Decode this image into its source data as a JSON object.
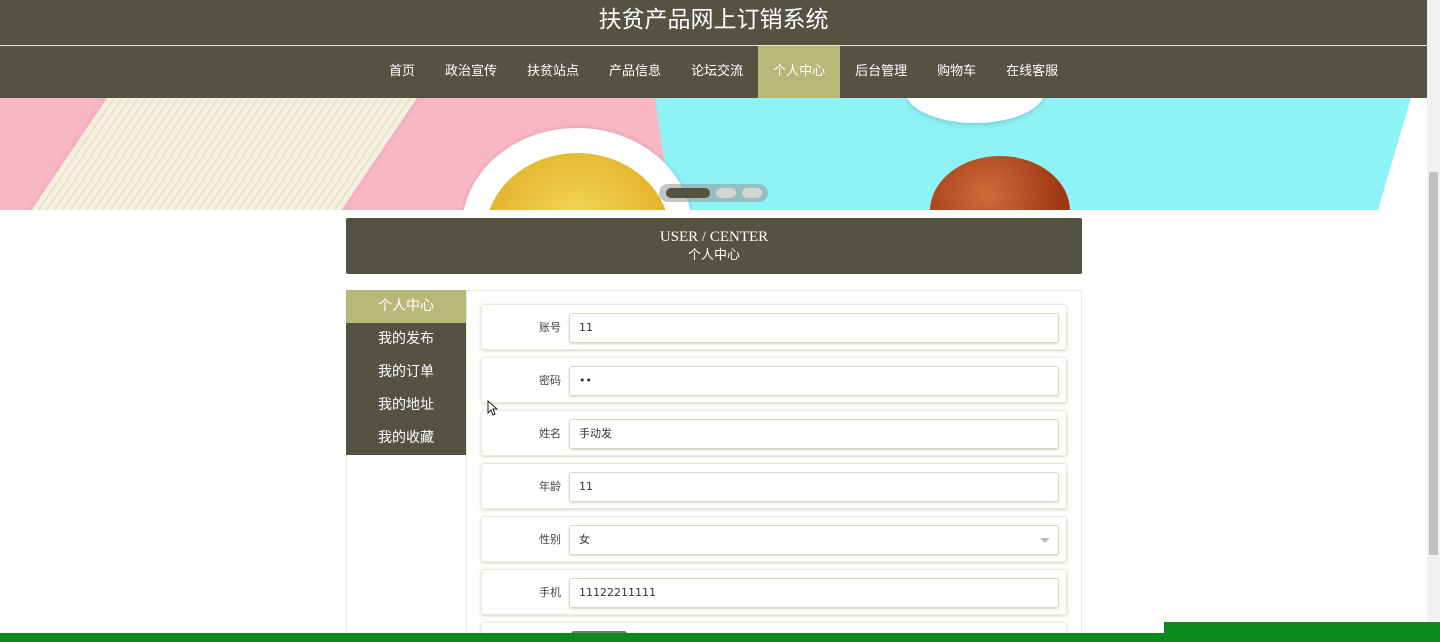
{
  "header": {
    "title": "扶贫产品网上订销系统"
  },
  "nav": {
    "items": [
      "首页",
      "政治宣传",
      "扶贫站点",
      "产品信息",
      "论坛交流",
      "个人中心",
      "后台管理",
      "购物车",
      "在线客服"
    ],
    "active_index": 5
  },
  "banner": {
    "slide_count": 3,
    "active_slide": 1
  },
  "section": {
    "title_en": "USER / CENTER",
    "title_cn": "个人中心"
  },
  "side_menu": {
    "items": [
      "个人中心",
      "我的发布",
      "我的订单",
      "我的地址",
      "我的收藏"
    ],
    "active_index": 0
  },
  "form": {
    "fields": [
      {
        "label": "账号",
        "value": "11"
      },
      {
        "label": "密码",
        "value": "••"
      },
      {
        "label": "姓名",
        "value": "手动发"
      },
      {
        "label": "年龄",
        "value": "11"
      },
      {
        "label": "性别",
        "value": "女"
      },
      {
        "label": "手机",
        "value": "11122211111"
      }
    ]
  },
  "colors": {
    "primary": "#545241",
    "accent": "#b8b878",
    "bottom_bar": "#0c8a1c"
  }
}
